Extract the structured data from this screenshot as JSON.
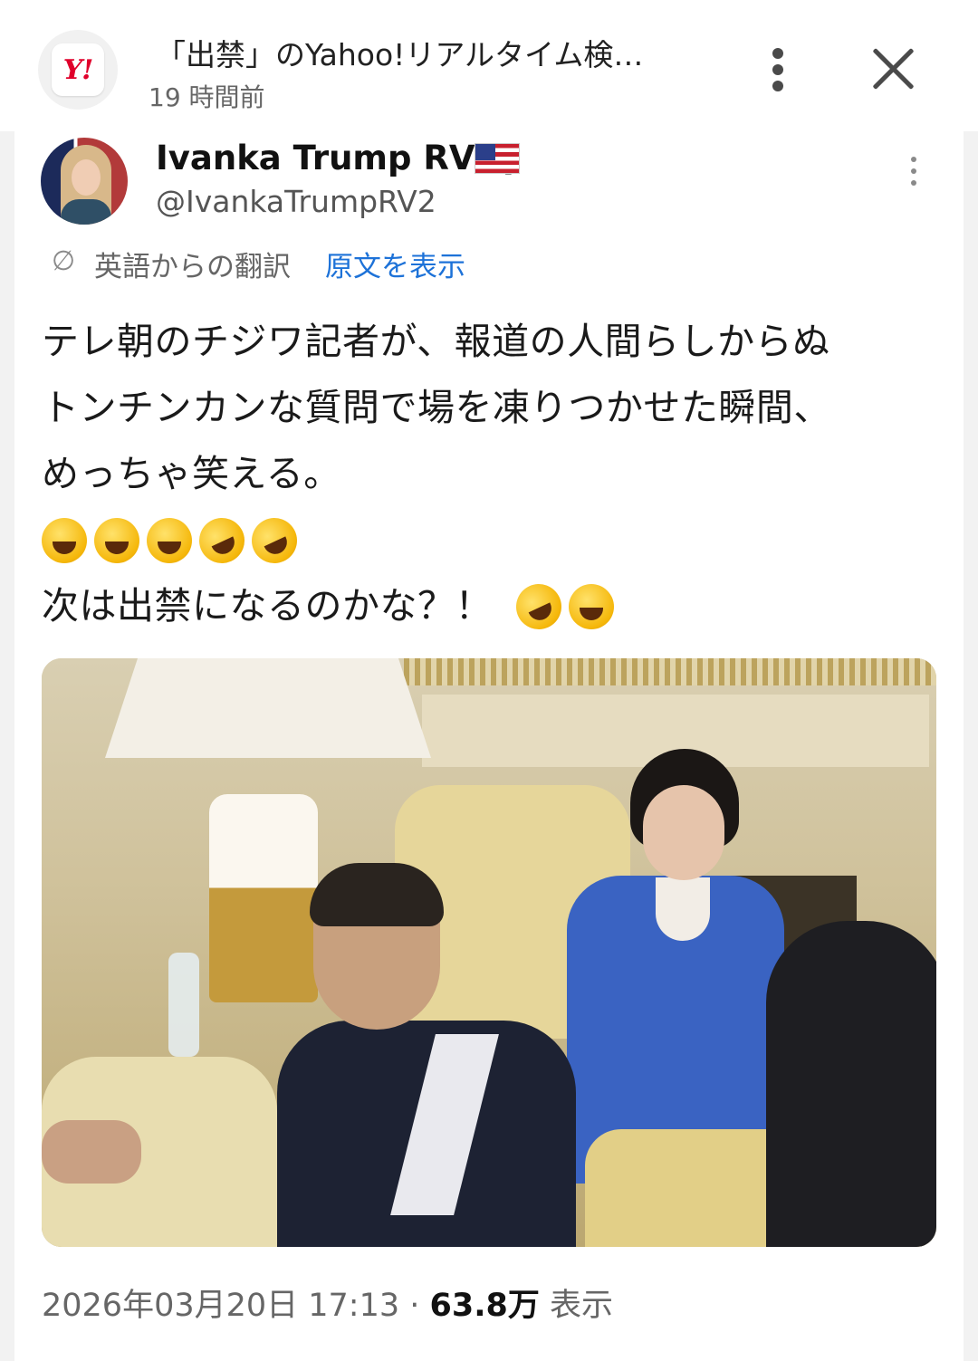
{
  "header": {
    "app_icon_text": "Y!",
    "title": "「出禁」のYahoo!リアルタイム検…",
    "time": "19 時間前"
  },
  "tweet": {
    "display_name": "Ivanka Trump RV Q",
    "handle": "@IvankaTrumpRV2",
    "translation_label": "英語からの翻訳",
    "show_original_label": "原文を表示",
    "body_lines": [
      "テレ朝のチジワ記者が、報道の人間らしからぬ",
      "トンチンカンな質問で場を凍りつかせた瞬間、",
      "めっちゃ笑える。"
    ],
    "emoji_line": [
      "joy",
      "joy",
      "joy",
      "rofl",
      "rofl"
    ],
    "last_line": "次は出禁になるのかな？！",
    "last_line_emoji": [
      "rofl",
      "joy"
    ],
    "timestamp": "2026年03月20日 17:13 · ",
    "views": "63.8万",
    "views_label": " 表示"
  },
  "colors": {
    "link_blue": "#1d72d8",
    "yahoo_red": "#e0002b"
  }
}
